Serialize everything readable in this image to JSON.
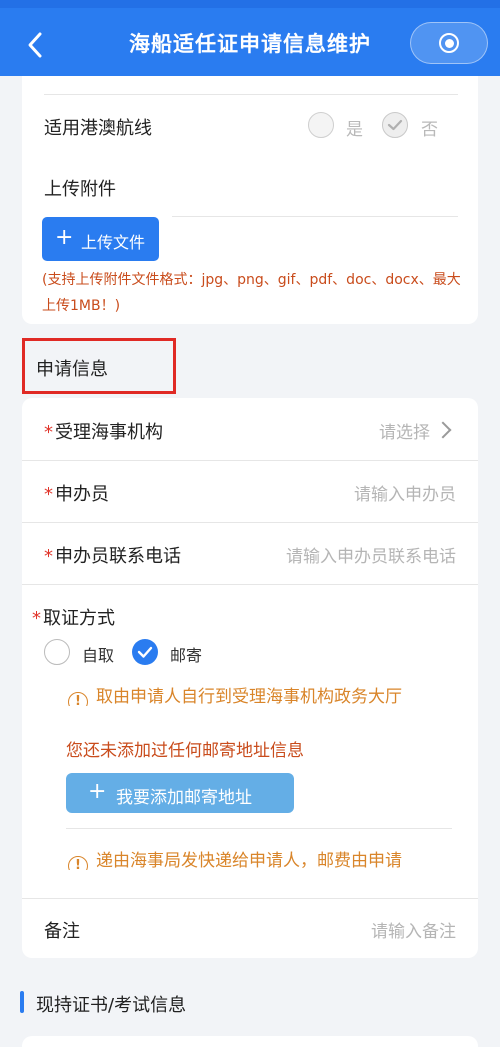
{
  "header": {
    "title": "海船适任证申请信息维护"
  },
  "attachment_card": {
    "hk_macau_route": {
      "label": "适用港澳航线",
      "option_yes": "是",
      "option_no": "否"
    },
    "upload": {
      "label": "上传附件",
      "button_label": "上传文件",
      "hint": "(支持上传附件文件格式：jpg、png、gif、pdf、doc、docx、最大上传1MB！)"
    }
  },
  "application_info": {
    "section_title": "申请信息",
    "agency": {
      "required_mark": "*",
      "label": "受理海事机构",
      "placeholder": "请选择"
    },
    "applicant": {
      "required_mark": "*",
      "label": "申办员",
      "placeholder": "请输入申办员"
    },
    "phone": {
      "required_mark": "*",
      "label": "申办员联系电话",
      "placeholder": "请输入申办员联系电话"
    },
    "pickup": {
      "required_mark": "*",
      "label": "取证方式",
      "option_self": "自取",
      "option_mail": "邮寄",
      "selected": "邮寄",
      "notice_self": "取由申请人自行到受理海事机构政务大厅",
      "no_address": "您还未添加过任何邮寄地址信息",
      "add_address_button": "我要添加邮寄地址",
      "notice_mail": "递由海事局发快递给申请人，邮费由申请"
    },
    "remark": {
      "label": "备注",
      "placeholder": "请输入备注"
    }
  },
  "certificate_section": {
    "title": "现持证书/考试信息"
  },
  "colors": {
    "primary": "#2a7cf0",
    "highlight_box": "#e02a25",
    "notice": "#d9852a",
    "warning_text": "#c94c1c"
  }
}
